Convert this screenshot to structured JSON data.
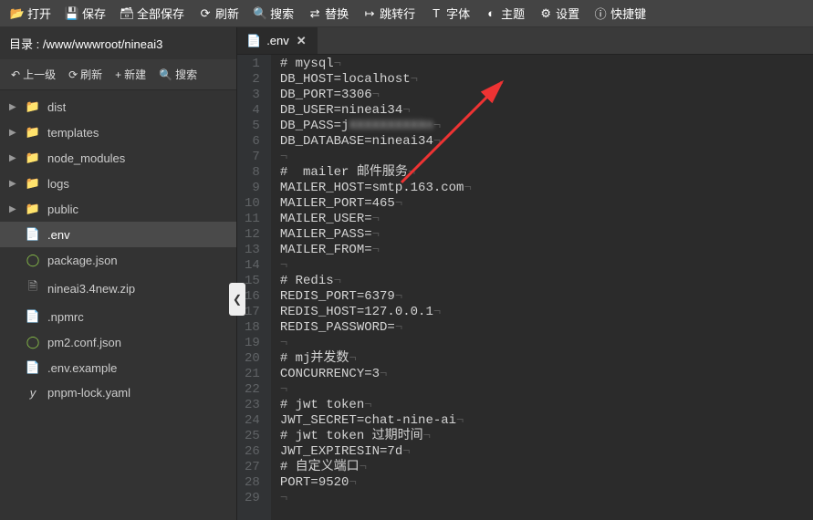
{
  "toolbar": {
    "open": "打开",
    "save": "保存",
    "save_all": "全部保存",
    "refresh": "刷新",
    "search": "搜索",
    "replace": "替换",
    "goto": "跳转行",
    "font": "字体",
    "theme": "主题",
    "settings": "设置",
    "shortcuts": "快捷键"
  },
  "path": {
    "label": "目录 :",
    "value": "/www/wwwroot/nineai3"
  },
  "sidebar_actions": {
    "up": "上一级",
    "refresh": "刷新",
    "new": "新建",
    "search": "搜索"
  },
  "tree": {
    "items": [
      {
        "type": "folder",
        "name": "dist"
      },
      {
        "type": "folder",
        "name": "templates"
      },
      {
        "type": "folder",
        "name": "node_modules"
      },
      {
        "type": "folder",
        "name": "logs"
      },
      {
        "type": "folder",
        "name": "public"
      },
      {
        "type": "file",
        "name": ".env",
        "icon": "env",
        "selected": true
      },
      {
        "type": "file",
        "name": "package.json",
        "icon": "json"
      },
      {
        "type": "file",
        "name": "nineai3.4new.zip",
        "icon": "zip"
      },
      {
        "type": "file",
        "name": ".npmrc",
        "icon": "npm"
      },
      {
        "type": "file",
        "name": "pm2.conf.json",
        "icon": "json"
      },
      {
        "type": "file",
        "name": ".env.example",
        "icon": "env"
      },
      {
        "type": "file",
        "name": "pnpm-lock.yaml",
        "icon": "yaml"
      }
    ]
  },
  "tab": {
    "name": ".env"
  },
  "code_lines": [
    "# mysql",
    "DB_HOST=localhost",
    "DB_PORT=3306",
    "DB_USER=nineai34",
    "DB_PASS=j",
    "DB_DATABASE=nineai34",
    "",
    "#  mailer 邮件服务",
    "MAILER_HOST=smtp.163.com",
    "MAILER_PORT=465",
    "MAILER_USER=",
    "MAILER_PASS=",
    "MAILER_FROM=",
    "",
    "# Redis",
    "REDIS_PORT=6379",
    "REDIS_HOST=127.0.0.1",
    "REDIS_PASSWORD=",
    "",
    "# mj并发数",
    "CONCURRENCY=3",
    "",
    "# jwt token",
    "JWT_SECRET=chat-nine-ai",
    "# jwt token 过期时间",
    "JWT_EXPIRESIN=7d",
    "# 自定义端口",
    "PORT=9520",
    ""
  ],
  "blurred_suffix": "XXXXXXXXXXn"
}
